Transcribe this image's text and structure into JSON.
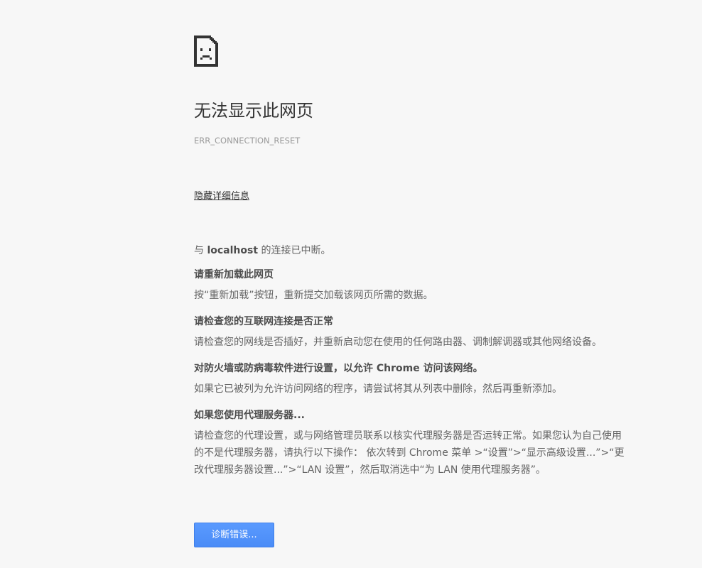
{
  "icon": "sad-document-icon",
  "colors": {
    "background": "#f7f7f7",
    "heading": "#333333",
    "body_text": "#646464",
    "error_code": "#9a9a9a",
    "button": "#4d90fe"
  },
  "error": {
    "title": "无法显示此网页",
    "code": "ERR_CONNECTION_RESET",
    "toggle_details_link": "隐藏详细信息"
  },
  "details": {
    "summary_prefix": "与 ",
    "summary_host": "localhost",
    "summary_suffix": " 的连接已中断。",
    "sections": [
      {
        "title": "请重新加载此网页",
        "body": "按“重新加载”按钮，重新提交加载该网页所需的数据。"
      },
      {
        "title": "请检查您的互联网连接是否正常",
        "body": "请检查您的网线是否插好，并重新启动您在使用的任何路由器、调制解调器或其他网络设备。"
      },
      {
        "title": "对防火墙或防病毒软件进行设置，以允许 Chrome 访问该网络。",
        "body": "如果它已被列为允许访问网络的程序，请尝试将其从列表中删除，然后再重新添加。"
      },
      {
        "title": "如果您使用代理服务器...",
        "body": "请检查您的代理设置，或与网络管理员联系以核实代理服务器是否运转正常。如果您认为自己使用的不是代理服务器，请执行以下操作： 依次转到 Chrome 菜单 >“设置”>“显示高级设置...”>“更改代理服务器设置...”>“LAN 设置”，然后取消选中“为 LAN 使用代理服务器”。"
      }
    ]
  },
  "diagnose_button": {
    "label": "诊断错误..."
  }
}
